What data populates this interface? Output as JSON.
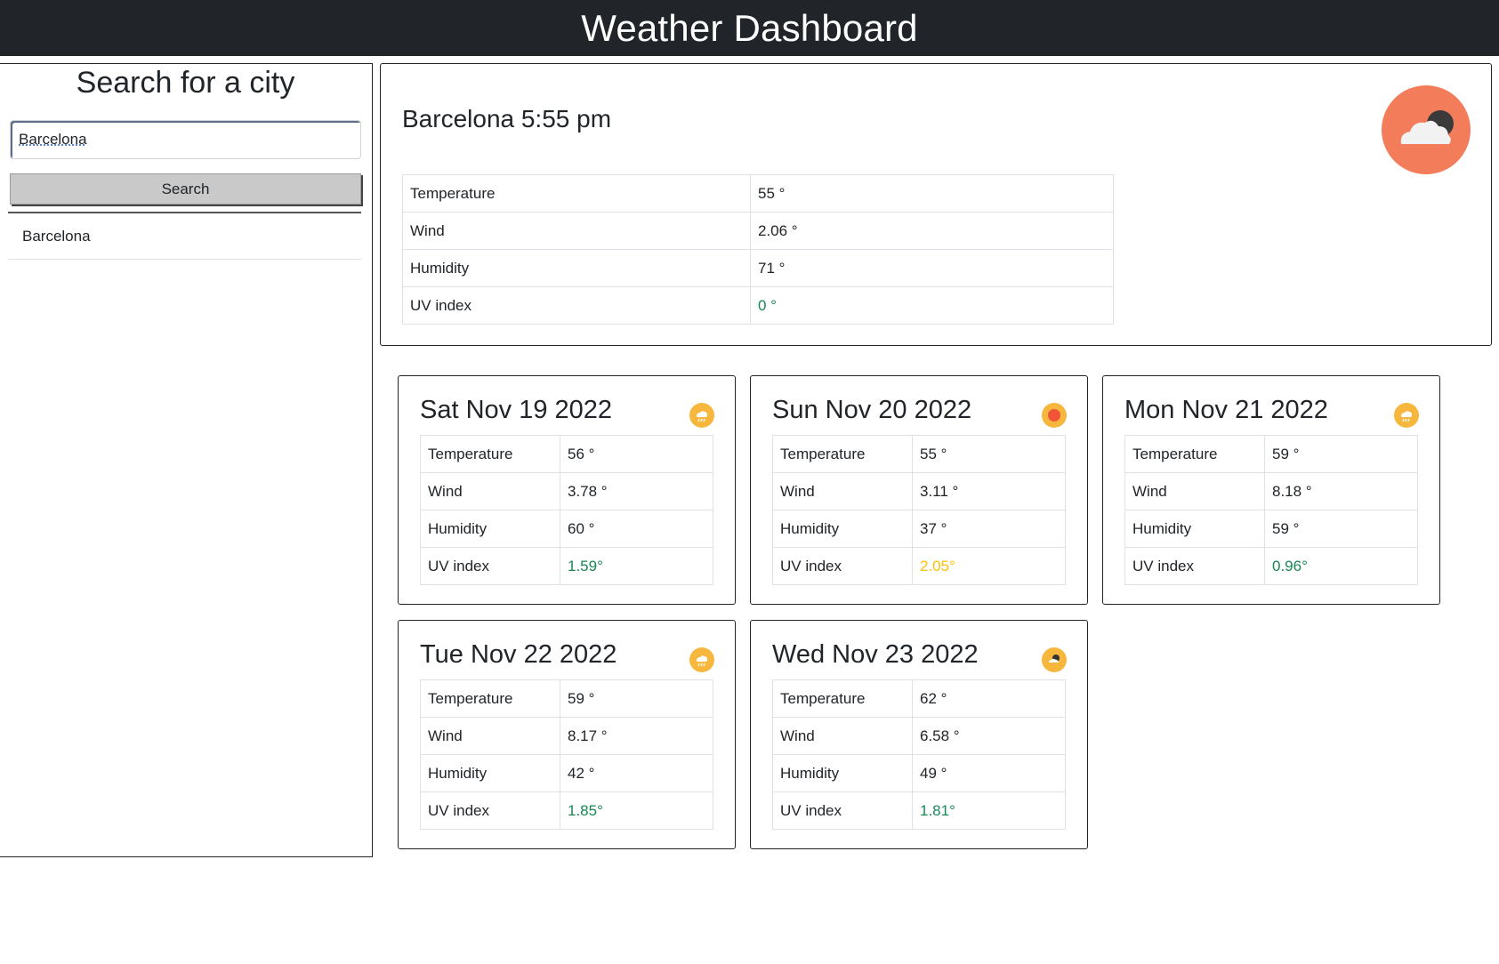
{
  "header": {
    "title": "Weather Dashboard"
  },
  "sidebar": {
    "title": "Search for a city",
    "search_value": "Barcelona",
    "search_button": "Search",
    "history": [
      "Barcelona"
    ]
  },
  "current": {
    "title": "Barcelona 5:55 pm",
    "icon": "cloud-moon-icon",
    "rows": [
      {
        "label": "Temperature",
        "value": "55 °"
      },
      {
        "label": "Wind",
        "value": "2.06 °"
      },
      {
        "label": "Humidity",
        "value": "71 °"
      },
      {
        "label": "UV index",
        "value": "0 °"
      }
    ]
  },
  "forecast": [
    {
      "date": "Sat Nov 19 2022",
      "icon": "rain-icon",
      "rows": [
        {
          "label": "Temperature",
          "value": "56 °"
        },
        {
          "label": "Wind",
          "value": "3.78 °"
        },
        {
          "label": "Humidity",
          "value": "60 °"
        },
        {
          "label": "UV index",
          "value": "1.59°"
        }
      ]
    },
    {
      "date": "Sun Nov 20 2022",
      "icon": "sun-icon",
      "rows": [
        {
          "label": "Temperature",
          "value": "55 °"
        },
        {
          "label": "Wind",
          "value": "3.11 °"
        },
        {
          "label": "Humidity",
          "value": "37 °"
        },
        {
          "label": "UV index",
          "value": "2.05°"
        }
      ]
    },
    {
      "date": "Mon Nov 21 2022",
      "icon": "rain-icon",
      "rows": [
        {
          "label": "Temperature",
          "value": "59 °"
        },
        {
          "label": "Wind",
          "value": "8.18 °"
        },
        {
          "label": "Humidity",
          "value": "59 °"
        },
        {
          "label": "UV index",
          "value": "0.96°"
        }
      ]
    },
    {
      "date": "Tue Nov 22 2022",
      "icon": "rain-icon",
      "rows": [
        {
          "label": "Temperature",
          "value": "59 °"
        },
        {
          "label": "Wind",
          "value": "8.17 °"
        },
        {
          "label": "Humidity",
          "value": "42 °"
        },
        {
          "label": "UV index",
          "value": "1.85°"
        }
      ]
    },
    {
      "date": "Wed Nov 23 2022",
      "icon": "cloud-moon-icon",
      "rows": [
        {
          "label": "Temperature",
          "value": "62 °"
        },
        {
          "label": "Wind",
          "value": "6.58 °"
        },
        {
          "label": "Humidity",
          "value": "49 °"
        },
        {
          "label": "UV index",
          "value": "1.81°"
        }
      ]
    }
  ],
  "colors": {
    "header_bg": "#212529",
    "current_icon_bg": "#f37d5a",
    "forecast_icon_bg": "#f6b73c",
    "uv_low": "#198754",
    "uv_moderate": "#ffc107"
  }
}
